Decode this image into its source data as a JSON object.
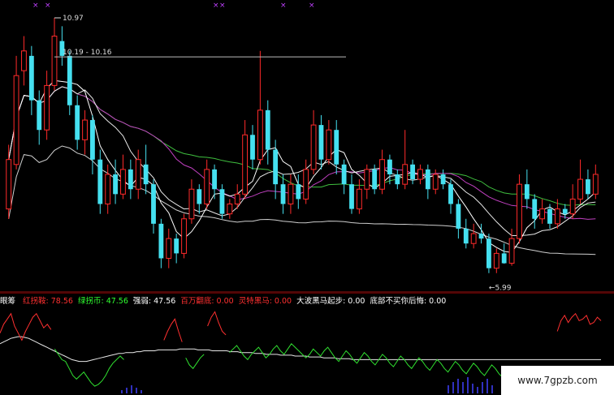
{
  "chart_data": {
    "type": "candlestick",
    "annotations": {
      "high_label": "10.97",
      "range_label": "10.19 - 10.16",
      "low_label": "←5.99"
    },
    "price": {
      "ylim": [
        5.5,
        11.2
      ],
      "candles": [
        {
          "o": 7.1,
          "c": 8.1,
          "h": 8.4,
          "l": 6.9
        },
        {
          "o": 8.0,
          "c": 9.8,
          "h": 10.2,
          "l": 7.9
        },
        {
          "o": 9.9,
          "c": 10.3,
          "h": 10.6,
          "l": 9.6
        },
        {
          "o": 10.2,
          "c": 9.3,
          "h": 10.4,
          "l": 9.0
        },
        {
          "o": 9.3,
          "c": 8.7,
          "h": 9.5,
          "l": 8.4
        },
        {
          "o": 8.7,
          "c": 9.6,
          "h": 9.9,
          "l": 8.5
        },
        {
          "o": 9.6,
          "c": 10.6,
          "h": 10.97,
          "l": 9.5
        },
        {
          "o": 10.5,
          "c": 10.2,
          "h": 10.8,
          "l": 10.0
        },
        {
          "o": 10.2,
          "c": 9.2,
          "h": 10.3,
          "l": 9.0
        },
        {
          "o": 9.2,
          "c": 8.5,
          "h": 9.4,
          "l": 8.3
        },
        {
          "o": 8.5,
          "c": 8.9,
          "h": 9.1,
          "l": 8.2
        },
        {
          "o": 8.9,
          "c": 8.1,
          "h": 9.0,
          "l": 7.8
        },
        {
          "o": 8.1,
          "c": 7.2,
          "h": 8.3,
          "l": 7.0
        },
        {
          "o": 7.2,
          "c": 7.8,
          "h": 8.0,
          "l": 7.0
        },
        {
          "o": 7.8,
          "c": 7.4,
          "h": 8.1,
          "l": 7.2
        },
        {
          "o": 7.4,
          "c": 7.9,
          "h": 8.2,
          "l": 7.3
        },
        {
          "o": 7.9,
          "c": 7.5,
          "h": 8.1,
          "l": 7.3
        },
        {
          "o": 7.5,
          "c": 8.1,
          "h": 8.3,
          "l": 7.3
        },
        {
          "o": 8.0,
          "c": 7.6,
          "h": 8.4,
          "l": 7.4
        },
        {
          "o": 7.6,
          "c": 6.8,
          "h": 7.7,
          "l": 6.6
        },
        {
          "o": 6.8,
          "c": 6.1,
          "h": 6.9,
          "l": 5.9
        },
        {
          "o": 6.1,
          "c": 6.5,
          "h": 6.7,
          "l": 5.9
        },
        {
          "o": 6.5,
          "c": 6.2,
          "h": 6.6,
          "l": 6.0
        },
        {
          "o": 6.2,
          "c": 6.9,
          "h": 7.0,
          "l": 6.1
        },
        {
          "o": 6.9,
          "c": 7.5,
          "h": 7.7,
          "l": 6.8
        },
        {
          "o": 7.5,
          "c": 7.2,
          "h": 7.6,
          "l": 7.0
        },
        {
          "o": 7.2,
          "c": 7.9,
          "h": 8.1,
          "l": 7.1
        },
        {
          "o": 7.9,
          "c": 7.5,
          "h": 8.0,
          "l": 7.3
        },
        {
          "o": 7.5,
          "c": 7.0,
          "h": 7.6,
          "l": 6.9
        },
        {
          "o": 7.0,
          "c": 7.2,
          "h": 7.3,
          "l": 6.9
        },
        {
          "o": 7.2,
          "c": 7.4,
          "h": 7.6,
          "l": 7.1
        },
        {
          "o": 7.4,
          "c": 8.6,
          "h": 8.9,
          "l": 7.3
        },
        {
          "o": 8.6,
          "c": 8.1,
          "h": 8.8,
          "l": 7.9
        },
        {
          "o": 8.1,
          "c": 9.1,
          "h": 10.3,
          "l": 8.0
        },
        {
          "o": 9.1,
          "c": 8.3,
          "h": 9.3,
          "l": 8.0
        },
        {
          "o": 8.3,
          "c": 7.6,
          "h": 8.5,
          "l": 7.3
        },
        {
          "o": 7.6,
          "c": 7.2,
          "h": 7.8,
          "l": 7.0
        },
        {
          "o": 7.2,
          "c": 7.6,
          "h": 7.8,
          "l": 7.0
        },
        {
          "o": 7.6,
          "c": 7.3,
          "h": 7.8,
          "l": 7.1
        },
        {
          "o": 7.3,
          "c": 7.9,
          "h": 8.1,
          "l": 7.2
        },
        {
          "o": 7.9,
          "c": 8.8,
          "h": 9.1,
          "l": 7.8
        },
        {
          "o": 8.8,
          "c": 8.1,
          "h": 9.0,
          "l": 7.9
        },
        {
          "o": 8.1,
          "c": 8.7,
          "h": 8.9,
          "l": 8.0
        },
        {
          "o": 8.7,
          "c": 8.0,
          "h": 8.9,
          "l": 7.8
        },
        {
          "o": 8.0,
          "c": 7.6,
          "h": 8.1,
          "l": 7.4
        },
        {
          "o": 7.6,
          "c": 7.1,
          "h": 7.8,
          "l": 7.0
        },
        {
          "o": 7.1,
          "c": 7.5,
          "h": 7.7,
          "l": 7.0
        },
        {
          "o": 7.5,
          "c": 7.9,
          "h": 8.0,
          "l": 7.3
        },
        {
          "o": 7.9,
          "c": 7.5,
          "h": 8.0,
          "l": 7.4
        },
        {
          "o": 7.5,
          "c": 8.1,
          "h": 8.3,
          "l": 7.4
        },
        {
          "o": 8.1,
          "c": 7.8,
          "h": 8.2,
          "l": 7.6
        },
        {
          "o": 7.8,
          "c": 7.6,
          "h": 7.9,
          "l": 7.5
        },
        {
          "o": 7.6,
          "c": 8.0,
          "h": 8.7,
          "l": 7.5
        },
        {
          "o": 8.0,
          "c": 7.7,
          "h": 8.1,
          "l": 7.6
        },
        {
          "o": 7.7,
          "c": 7.9,
          "h": 8.0,
          "l": 7.6
        },
        {
          "o": 7.9,
          "c": 7.5,
          "h": 8.0,
          "l": 7.3
        },
        {
          "o": 7.5,
          "c": 7.8,
          "h": 7.9,
          "l": 7.4
        },
        {
          "o": 7.8,
          "c": 7.6,
          "h": 7.9,
          "l": 7.5
        },
        {
          "o": 7.6,
          "c": 7.2,
          "h": 7.7,
          "l": 7.0
        },
        {
          "o": 7.2,
          "c": 6.7,
          "h": 7.3,
          "l": 6.5
        },
        {
          "o": 6.7,
          "c": 6.4,
          "h": 6.9,
          "l": 6.3
        },
        {
          "o": 6.4,
          "c": 6.6,
          "h": 6.8,
          "l": 6.3
        },
        {
          "o": 6.6,
          "c": 6.5,
          "h": 6.8,
          "l": 6.4
        },
        {
          "o": 6.5,
          "c": 5.9,
          "h": 6.6,
          "l": 5.8
        },
        {
          "o": 5.9,
          "c": 6.2,
          "h": 6.3,
          "l": 5.8
        },
        {
          "o": 6.2,
          "c": 6.0,
          "h": 6.4,
          "l": 5.99
        },
        {
          "o": 6.0,
          "c": 6.5,
          "h": 6.7,
          "l": 5.95
        },
        {
          "o": 6.5,
          "c": 7.6,
          "h": 7.8,
          "l": 6.4
        },
        {
          "o": 7.6,
          "c": 7.3,
          "h": 7.9,
          "l": 7.1
        },
        {
          "o": 7.3,
          "c": 6.9,
          "h": 7.4,
          "l": 6.7
        },
        {
          "o": 6.9,
          "c": 7.1,
          "h": 7.3,
          "l": 6.8
        },
        {
          "o": 7.1,
          "c": 6.8,
          "h": 7.2,
          "l": 6.7
        },
        {
          "o": 6.8,
          "c": 7.1,
          "h": 7.3,
          "l": 6.7
        },
        {
          "o": 7.1,
          "c": 7.0,
          "h": 7.2,
          "l": 6.9
        },
        {
          "o": 7.0,
          "c": 7.3,
          "h": 7.6,
          "l": 6.9
        },
        {
          "o": 7.3,
          "c": 7.7,
          "h": 8.1,
          "l": 7.2
        },
        {
          "o": 7.7,
          "c": 7.4,
          "h": 7.9,
          "l": 7.3
        },
        {
          "o": 7.4,
          "c": 7.8,
          "h": 8.0,
          "l": 7.3
        }
      ]
    },
    "indicator": {
      "title": "眼筹",
      "legend": [
        {
          "name": "红拐鞍",
          "value": "78.56",
          "color": "#ff3030"
        },
        {
          "name": "绿拐币",
          "value": "47.56",
          "color": "#30ff30"
        },
        {
          "name": "强弱",
          "value": "47.56",
          "color": "#ffffff"
        },
        {
          "name": "百万翻底",
          "value": "0.00",
          "color": "#ff3030"
        },
        {
          "name": "灵特黑马",
          "value": "0.00",
          "color": "#ff3030"
        },
        {
          "name": "大波黑马起步",
          "value": "0.00",
          "color": "#ffffff"
        },
        {
          "name": "底部不买你后悔",
          "value": "0.00",
          "color": "#ffffff"
        }
      ],
      "ylim": [
        0,
        100
      ],
      "red": [
        70,
        80,
        86,
        92,
        78,
        70,
        62,
        72,
        80,
        88,
        92,
        84,
        76,
        80,
        74,
        0,
        0,
        0,
        0,
        0,
        0,
        0,
        0,
        0,
        0,
        0,
        0,
        0,
        0,
        0,
        0,
        0,
        0,
        0,
        0,
        0,
        0,
        0,
        0,
        0,
        0,
        0,
        0,
        0,
        0,
        62,
        72,
        80,
        86,
        72,
        60,
        0,
        0,
        0,
        0,
        0,
        0,
        78,
        88,
        94,
        82,
        72,
        68,
        0,
        0,
        0,
        0,
        0,
        0,
        0,
        0,
        0,
        0,
        0,
        0,
        0,
        0,
        0,
        0,
        0,
        0,
        0,
        0,
        0,
        0,
        0,
        0,
        0,
        0,
        0,
        0,
        0,
        0,
        0,
        0,
        0,
        0,
        0,
        0,
        0,
        0,
        0,
        0,
        0,
        0,
        0,
        0,
        0,
        0,
        0,
        0,
        0,
        0,
        0,
        0,
        0,
        0,
        0,
        0,
        0,
        0,
        0,
        0,
        0,
        0,
        0,
        0,
        0,
        0,
        0,
        0,
        0,
        0,
        0,
        0,
        0,
        0,
        0,
        0,
        0,
        0,
        0,
        0,
        0,
        0,
        0,
        0,
        0,
        0,
        0,
        0,
        0,
        0,
        72,
        84,
        90,
        82,
        88,
        92,
        84,
        86,
        90,
        80,
        82,
        88,
        84
      ],
      "green": [
        0,
        0,
        0,
        0,
        0,
        0,
        0,
        0,
        0,
        0,
        0,
        0,
        0,
        0,
        0,
        52,
        46,
        40,
        38,
        30,
        22,
        18,
        22,
        26,
        20,
        14,
        10,
        12,
        16,
        22,
        30,
        36,
        40,
        44,
        40,
        0,
        0,
        0,
        0,
        0,
        0,
        0,
        0,
        0,
        0,
        0,
        0,
        0,
        0,
        0,
        0,
        42,
        34,
        30,
        36,
        42,
        46,
        0,
        0,
        0,
        0,
        0,
        0,
        48,
        52,
        56,
        50,
        44,
        40,
        46,
        50,
        54,
        48,
        42,
        46,
        52,
        56,
        50,
        46,
        52,
        58,
        54,
        50,
        46,
        42,
        46,
        52,
        48,
        44,
        50,
        54,
        48,
        42,
        38,
        44,
        50,
        46,
        40,
        36,
        42,
        48,
        44,
        38,
        34,
        40,
        46,
        42,
        36,
        32,
        38,
        44,
        40,
        34,
        30,
        36,
        42,
        38,
        32,
        28,
        34,
        40,
        36,
        30,
        26,
        32,
        38,
        34,
        28,
        24,
        30,
        36,
        32,
        26,
        22,
        28,
        34,
        30,
        24,
        20,
        26,
        32,
        28,
        22,
        18,
        24,
        30,
        26,
        20,
        16,
        22,
        28,
        24,
        20,
        0,
        0,
        0,
        0,
        0,
        0,
        0,
        0,
        0,
        0,
        0,
        0,
        0
      ],
      "white": [
        58,
        60,
        62,
        64,
        65,
        66,
        66,
        65,
        64,
        62,
        60,
        58,
        56,
        54,
        52,
        50,
        48,
        46,
        44,
        42,
        40,
        39,
        38,
        38,
        38,
        39,
        40,
        41,
        42,
        43,
        44,
        45,
        46,
        47,
        47,
        48,
        48,
        48,
        49,
        49,
        50,
        50,
        50,
        50,
        51,
        51,
        51,
        51,
        51,
        51,
        52,
        52,
        52,
        52,
        52,
        51,
        51,
        51,
        51,
        50,
        50,
        50,
        50,
        50,
        49,
        49,
        49,
        48,
        48,
        48,
        48,
        47,
        47,
        47,
        46,
        46,
        46,
        46,
        45,
        45,
        45,
        45,
        44,
        44,
        44,
        44,
        43,
        43,
        43,
        43,
        42,
        42,
        42,
        42,
        41,
        41,
        41,
        41,
        40,
        40,
        40,
        40,
        40,
        40,
        40,
        40,
        40,
        40,
        40,
        40,
        40,
        40,
        40,
        40,
        40,
        40,
        40,
        40,
        40,
        40,
        40,
        40,
        40,
        40,
        40,
        40,
        40,
        40,
        40,
        40,
        40,
        40,
        40,
        40,
        40,
        40,
        40,
        40,
        40,
        40,
        40,
        40,
        40,
        40,
        40,
        40,
        40,
        40,
        40,
        40,
        40,
        40,
        40,
        40,
        40,
        40,
        40,
        40,
        40,
        40,
        40,
        40,
        40,
        40,
        40,
        40,
        40,
        40
      ]
    }
  },
  "watermark": "www.7gpzb.com"
}
